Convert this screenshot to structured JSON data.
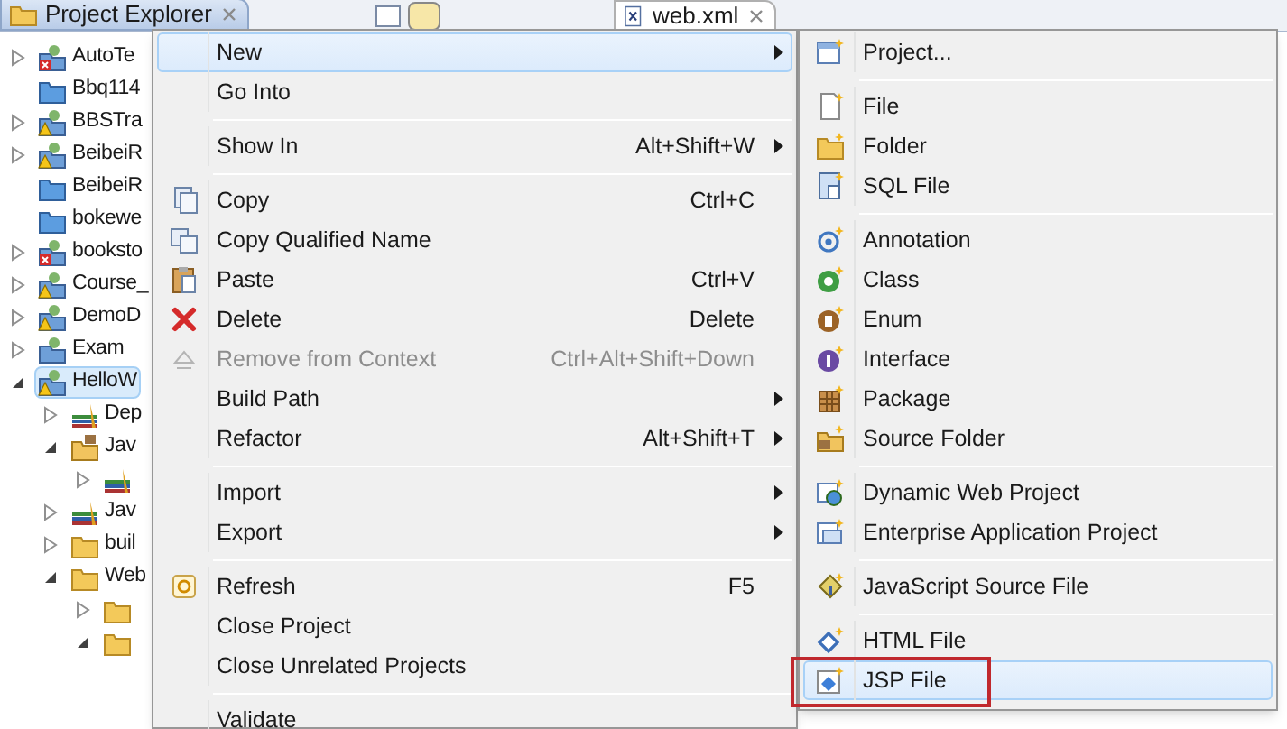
{
  "tabs": [
    {
      "label": "Project Explorer",
      "selected": true
    },
    {
      "label": "web.xml",
      "selected": false
    }
  ],
  "tree": [
    {
      "label": "AutoTe",
      "expanded": false,
      "kind": "error",
      "selected": false
    },
    {
      "label": "Bbq114",
      "kind": "closed",
      "selected": false
    },
    {
      "label": "BBSTra",
      "expanded": false,
      "kind": "warning",
      "selected": false
    },
    {
      "label": "BeibeiR",
      "expanded": false,
      "kind": "warning",
      "selected": false
    },
    {
      "label": "BeibeiR",
      "kind": "closed",
      "selected": false
    },
    {
      "label": "bokewe",
      "kind": "closed",
      "selected": false
    },
    {
      "label": "booksto",
      "expanded": false,
      "kind": "error",
      "selected": false
    },
    {
      "label": "Course_",
      "expanded": false,
      "kind": "warning",
      "selected": false
    },
    {
      "label": "DemoD",
      "expanded": false,
      "kind": "warning",
      "selected": false
    },
    {
      "label": "Exam",
      "expanded": false,
      "kind": "project",
      "selected": false
    },
    {
      "label": "HelloW",
      "expanded": true,
      "kind": "warning",
      "selected": true,
      "children": [
        {
          "label": "Dep",
          "expanded": false,
          "kind": "library",
          "selected": false
        },
        {
          "label": "Jav",
          "expanded": true,
          "kind": "source",
          "selected": false,
          "children": [
            {
              "expanded": false,
              "kind": "library",
              "selected": false
            }
          ]
        },
        {
          "label": "Jav",
          "expanded": false,
          "kind": "library",
          "selected": false
        },
        {
          "label": "buil",
          "expanded": false,
          "kind": "folder",
          "selected": false
        },
        {
          "label": "Web",
          "expanded": true,
          "kind": "folder",
          "selected": false,
          "children": [
            {
              "expanded": false,
              "kind": "folder",
              "selected": false
            },
            {
              "expanded": true,
              "kind": "folder",
              "selected": false
            }
          ]
        }
      ]
    }
  ],
  "context_menu": [
    {
      "kind": "item",
      "label": "New",
      "submenu": true,
      "selected": true,
      "disabled": false
    },
    {
      "kind": "item",
      "label": "Go Into",
      "submenu": false,
      "selected": false,
      "disabled": false
    },
    {
      "kind": "separator"
    },
    {
      "kind": "item",
      "label": "Show In",
      "shortcut": "Alt+Shift+W",
      "submenu": true,
      "selected": false,
      "disabled": false
    },
    {
      "kind": "separator"
    },
    {
      "kind": "item",
      "label": "Copy",
      "shortcut": "Ctrl+C",
      "submenu": false,
      "selected": false,
      "disabled": false
    },
    {
      "kind": "item",
      "label": "Copy Qualified Name",
      "submenu": false,
      "selected": false,
      "disabled": false
    },
    {
      "kind": "item",
      "label": "Paste",
      "shortcut": "Ctrl+V",
      "submenu": false,
      "selected": false,
      "disabled": false
    },
    {
      "kind": "item",
      "label": "Delete",
      "shortcut": "Delete",
      "submenu": false,
      "selected": false,
      "disabled": false
    },
    {
      "kind": "item",
      "label": "Remove from Context",
      "shortcut": "Ctrl+Alt+Shift+Down",
      "submenu": false,
      "selected": false,
      "disabled": true
    },
    {
      "kind": "item",
      "label": "Build Path",
      "submenu": true,
      "selected": false,
      "disabled": false
    },
    {
      "kind": "item",
      "label": "Refactor",
      "shortcut": "Alt+Shift+T",
      "submenu": true,
      "selected": false,
      "disabled": false
    },
    {
      "kind": "separator"
    },
    {
      "kind": "item",
      "label": "Import",
      "submenu": true,
      "selected": false,
      "disabled": false
    },
    {
      "kind": "item",
      "label": "Export",
      "submenu": true,
      "selected": false,
      "disabled": false
    },
    {
      "kind": "separator"
    },
    {
      "kind": "item",
      "label": "Refresh",
      "shortcut": "F5",
      "submenu": false,
      "selected": false,
      "disabled": false
    },
    {
      "kind": "item",
      "label": "Close Project",
      "submenu": false,
      "selected": false,
      "disabled": false
    },
    {
      "kind": "item",
      "label": "Close Unrelated Projects",
      "submenu": false,
      "selected": false,
      "disabled": false
    },
    {
      "kind": "separator"
    },
    {
      "kind": "item",
      "label": "Validate",
      "submenu": false,
      "selected": false,
      "disabled": false
    }
  ],
  "new_submenu": [
    {
      "kind": "item",
      "label": "Project...",
      "selected": false,
      "outlined": false
    },
    {
      "kind": "separator"
    },
    {
      "kind": "item",
      "label": "File",
      "selected": false,
      "outlined": false
    },
    {
      "kind": "item",
      "label": "Folder",
      "selected": false,
      "outlined": false
    },
    {
      "kind": "item",
      "label": "SQL File",
      "selected": false,
      "outlined": false
    },
    {
      "kind": "separator"
    },
    {
      "kind": "item",
      "label": "Annotation",
      "selected": false,
      "outlined": false
    },
    {
      "kind": "item",
      "label": "Class",
      "selected": false,
      "outlined": false
    },
    {
      "kind": "item",
      "label": "Enum",
      "selected": false,
      "outlined": false
    },
    {
      "kind": "item",
      "label": "Interface",
      "selected": false,
      "outlined": false
    },
    {
      "kind": "item",
      "label": "Package",
      "selected": false,
      "outlined": false
    },
    {
      "kind": "item",
      "label": "Source Folder",
      "selected": false,
      "outlined": false
    },
    {
      "kind": "separator"
    },
    {
      "kind": "item",
      "label": "Dynamic Web Project",
      "selected": false,
      "outlined": false
    },
    {
      "kind": "item",
      "label": "Enterprise Application Project",
      "selected": false,
      "outlined": false
    },
    {
      "kind": "separator"
    },
    {
      "kind": "item",
      "label": "JavaScript Source File",
      "selected": false,
      "outlined": false
    },
    {
      "kind": "separator"
    },
    {
      "kind": "item",
      "label": "HTML File",
      "selected": false,
      "outlined": false
    },
    {
      "kind": "item",
      "label": "JSP File",
      "selected": true,
      "outlined": true
    }
  ]
}
